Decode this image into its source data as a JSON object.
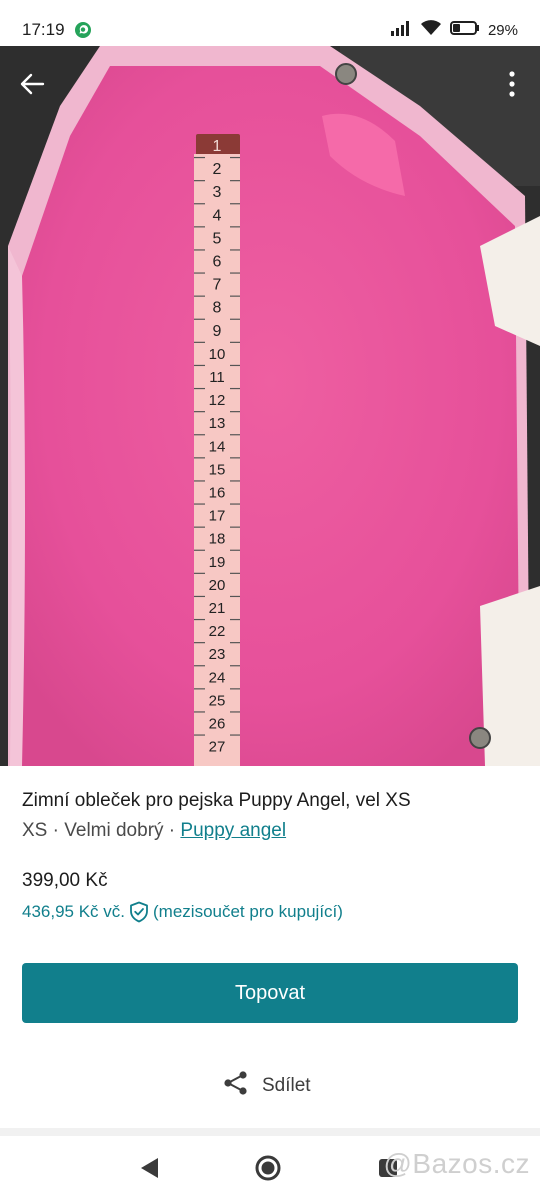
{
  "status_bar": {
    "time": "17:19",
    "battery": "29%",
    "icons": [
      "whatsapp-icon",
      "signal-icon",
      "wifi-icon",
      "battery-icon"
    ]
  },
  "gallery": {
    "icons": [
      "back-arrow-icon",
      "more-vert-icon"
    ],
    "page_indicator": {
      "count": 5,
      "active_index": 2
    },
    "ruler_numbers": [
      "1",
      "2",
      "3",
      "4",
      "5",
      "6",
      "7",
      "8",
      "9",
      "10",
      "11",
      "12",
      "13",
      "14",
      "15",
      "16",
      "17",
      "18",
      "19",
      "20",
      "21",
      "22",
      "23",
      "24",
      "25",
      "26",
      "27"
    ]
  },
  "listing": {
    "title": "Zimní obleček pro pejska Puppy Angel, vel XS",
    "size": "XS",
    "sep1": " · ",
    "condition": "Velmi dobrý",
    "sep2": " · ",
    "brand": "Puppy angel",
    "price": "399,00 Kč",
    "buyer_price": "436,95 Kč vč.",
    "buyer_note": "(mezisoučet pro kupující)"
  },
  "actions": {
    "bump_label": "Topovat",
    "share_label": "Sdílet"
  },
  "watermark": "@Bazos.cz",
  "colors": {
    "accent": "#117f8c",
    "fleece": "#e8569a",
    "background": "#ffffff"
  }
}
